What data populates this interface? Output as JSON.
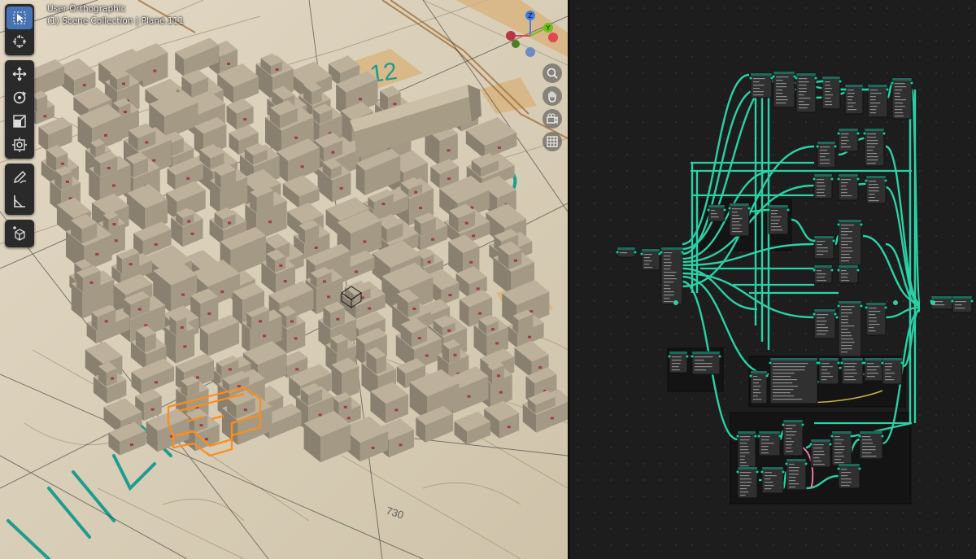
{
  "viewport": {
    "view_name": "User Orthographic",
    "context": "(1) Scene Collection | Plane.111"
  },
  "toolbar": {
    "tools": [
      {
        "name": "select-box-tool",
        "icon": "cursor-select-icon",
        "active": true
      },
      {
        "name": "cursor-tool",
        "icon": "crosshair-icon",
        "active": false
      },
      {
        "name": "move-tool",
        "icon": "move-arrows-icon",
        "active": false
      },
      {
        "name": "rotate-tool",
        "icon": "rotate-icon",
        "active": false
      },
      {
        "name": "scale-tool",
        "icon": "scale-icon",
        "active": false
      },
      {
        "name": "transform-tool",
        "icon": "transform-icon",
        "active": false
      },
      {
        "name": "annotate-tool",
        "icon": "pencil-icon",
        "active": false
      },
      {
        "name": "measure-tool",
        "icon": "ruler-icon",
        "active": false
      },
      {
        "name": "add-cube-tool",
        "icon": "add-cube-icon",
        "active": false
      }
    ]
  },
  "gizmo": {
    "x_label": "X",
    "y_label": "Y",
    "z_label": "Z"
  },
  "navigation": {
    "buttons": [
      {
        "name": "zoom-button",
        "icon": "magnifier-icon"
      },
      {
        "name": "pan-button",
        "icon": "hand-icon"
      },
      {
        "name": "camera-button",
        "icon": "camera-icon"
      },
      {
        "name": "grid-toggle-button",
        "icon": "grid-icon"
      }
    ]
  },
  "map_labels": {
    "number_a": "12",
    "number_b": "730"
  },
  "colors": {
    "accent": "#4772b3",
    "selection": "#ff8c1a",
    "geometry_link": "#2bd1a6",
    "node_bg": "#303030",
    "frame_bg": "#141414"
  }
}
